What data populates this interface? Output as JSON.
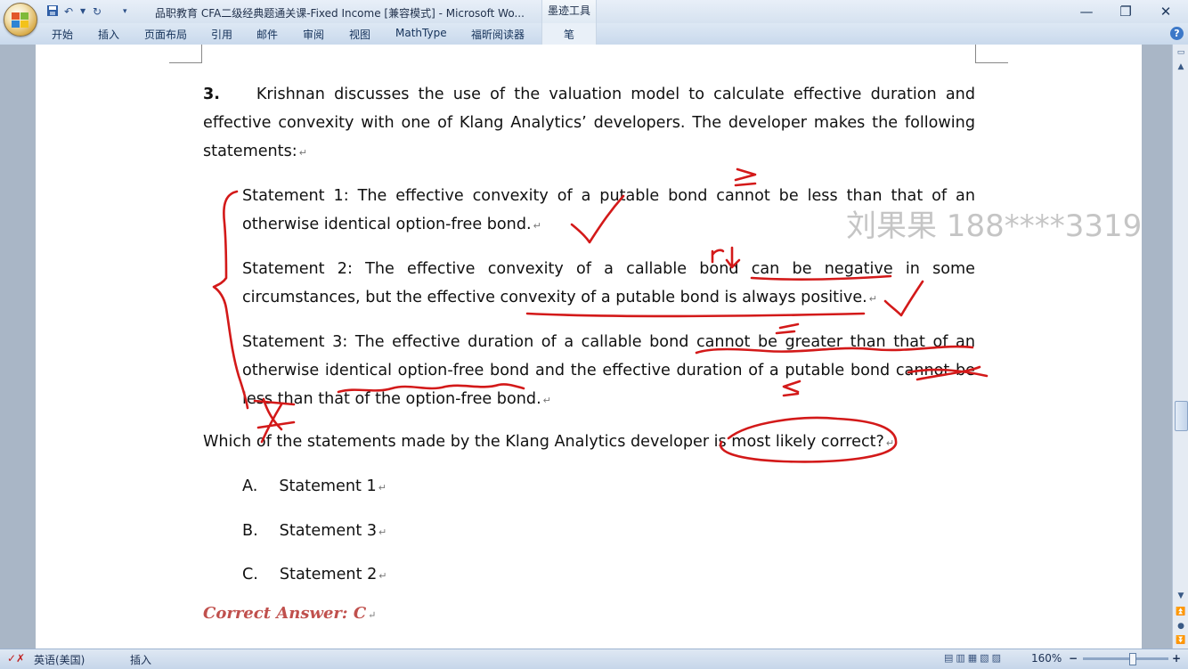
{
  "titlebar": {
    "title": "品职教育 CFA二级经典题通关课-Fixed Income [兼容模式] - Microsoft Wo...",
    "contextual_tab": "墨迹工具",
    "minimize": "—",
    "restore": "❐",
    "close": "✕"
  },
  "ribbon": {
    "tabs": [
      "开始",
      "插入",
      "页面布局",
      "引用",
      "邮件",
      "审阅",
      "视图",
      "MathType",
      "福昕阅读器"
    ],
    "pen_tab": "笔",
    "help": "?"
  },
  "document": {
    "question": {
      "number": "3.",
      "lines": [
        "Krishnan discusses the use of the valuation model to calculate effective duration and",
        "effective convexity with one of Klang Analytics’ developers. The developer makes the following",
        "statements:"
      ]
    },
    "statements": [
      [
        "Statement 1: The effective convexity of a putable bond cannot be less than that of an",
        "otherwise identical option-free bond."
      ],
      [
        "Statement 2: The effective convexity of a callable bond can be negative in some",
        "circumstances, but the effective convexity of a putable bond is always positive."
      ],
      [
        "Statement 3: The effective duration of a callable bond cannot be greater than that of an",
        "otherwise identical option-free bond and the effective duration of a putable bond cannot be",
        "less than that of the option-free bond."
      ]
    ],
    "prompt": "Which of the statements made by the Klang Analytics developer is most likely correct?",
    "options": [
      {
        "letter": "A.",
        "text": "Statement 1"
      },
      {
        "letter": "B.",
        "text": "Statement 3"
      },
      {
        "letter": "C.",
        "text": "Statement 2"
      }
    ],
    "answer": "Correct Answer: C",
    "paragraph_mark": "↵",
    "watermark": "刘果果 188****3319"
  },
  "statusbar": {
    "language": "英语(美国)",
    "mode": "插入",
    "zoom": "160%",
    "zoom_out": "−",
    "zoom_in": "+"
  },
  "colors": {
    "ink": "#d31919",
    "answer": "#c0504d",
    "ribbon_bg": "#c9d9ec"
  }
}
